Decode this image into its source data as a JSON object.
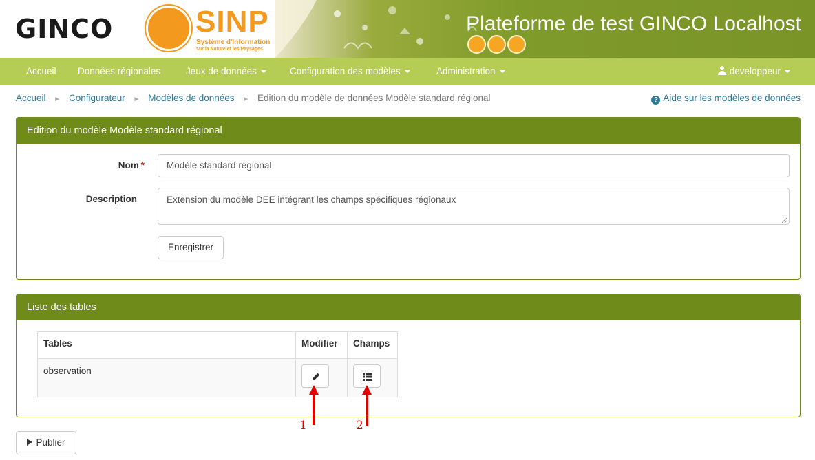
{
  "header": {
    "logo_text": "GINCO",
    "sinp_title": "SINP",
    "sinp_subtitle_1": "Système d'Information",
    "sinp_subtitle_2": "sur la Nature et les Paysages",
    "site_title": "Plateforme de test GINCO Localhost"
  },
  "navbar": {
    "items": [
      {
        "label": "Accueil"
      },
      {
        "label": "Données régionales"
      },
      {
        "label": "Jeux de données"
      },
      {
        "label": "Configuration des modèles"
      },
      {
        "label": "Administration"
      }
    ],
    "user": "developpeur"
  },
  "breadcrumb": {
    "items": [
      "Accueil",
      "Configurateur",
      "Modèles de données"
    ],
    "current": "Edition du modèle de données Modèle standard régional",
    "help_link": "Aide sur les modèles de données",
    "help_icon": "question-circle-icon"
  },
  "edit_panel": {
    "title": "Edition du modèle Modèle standard régional",
    "name_label": "Nom",
    "name_required_mark": "*",
    "name_value": "Modèle standard régional",
    "description_label": "Description",
    "description_value": "Extension du modèle DEE intégrant les champs spécifiques régionaux",
    "save_button": "Enregistrer"
  },
  "tables_panel": {
    "title": "Liste des tables",
    "columns": [
      "Tables",
      "Modifier",
      "Champs"
    ],
    "rows": [
      {
        "table": "observation",
        "edit_icon": "pencil-icon",
        "fields_icon": "list-icon"
      }
    ]
  },
  "publish_button": "Publier",
  "annotations": {
    "label_1": "1",
    "label_2": "2",
    "color": "#e00000"
  },
  "colors": {
    "navbar": "#b5cc55",
    "panel_header": "#6f8c1a",
    "link": "#2a7a9a",
    "sinp_orange": "#f39a1e"
  }
}
